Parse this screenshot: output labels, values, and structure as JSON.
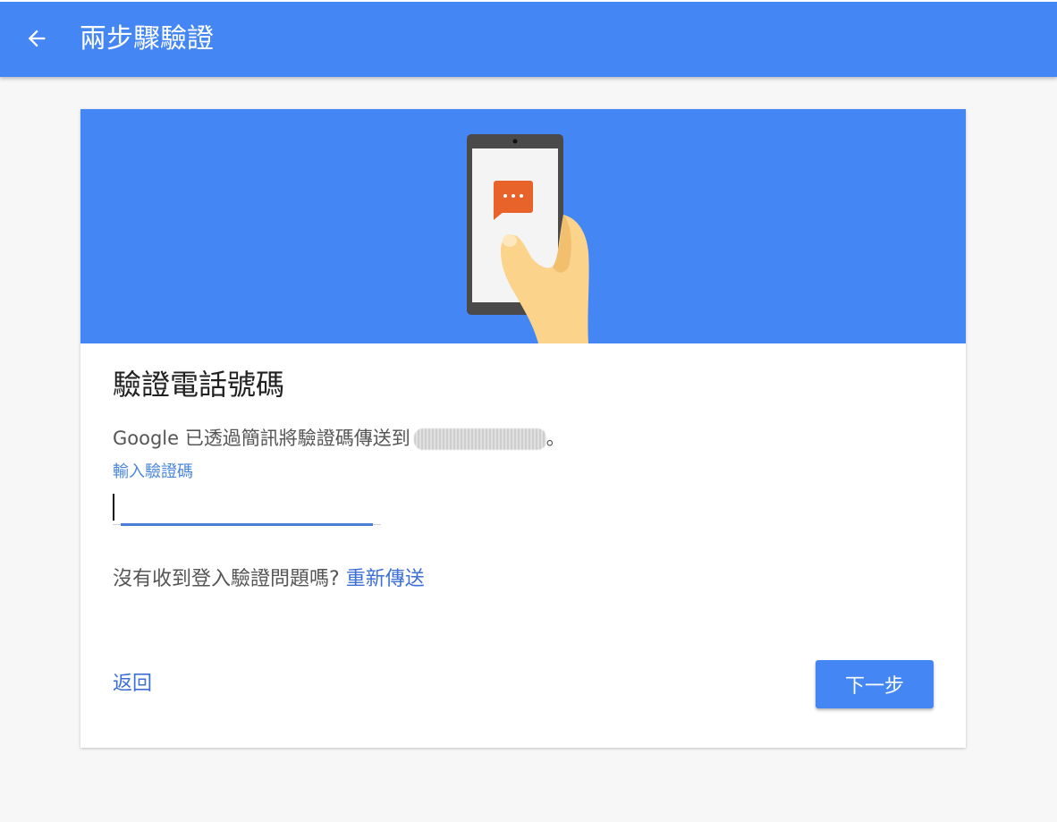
{
  "header": {
    "back_icon": "arrow-left-icon",
    "title": "兩步驟驗證"
  },
  "hero": {
    "illustration": "phone-with-message-icon",
    "colors": {
      "background": "#4486f4",
      "bubble": "#e8632a"
    }
  },
  "main": {
    "heading": "驗證電話號碼",
    "message": "Google 已透過簡訊將驗證碼傳送到",
    "message_suffix": "。",
    "field_label": "輸入驗證碼",
    "code_value": "",
    "resend_prompt": "沒有收到登入驗證問題嗎?",
    "resend_link": "重新傳送"
  },
  "footer": {
    "back_label": "返回",
    "next_label": "下一步"
  },
  "colors": {
    "accent": "#4486f4",
    "link": "#3d6fd6"
  }
}
